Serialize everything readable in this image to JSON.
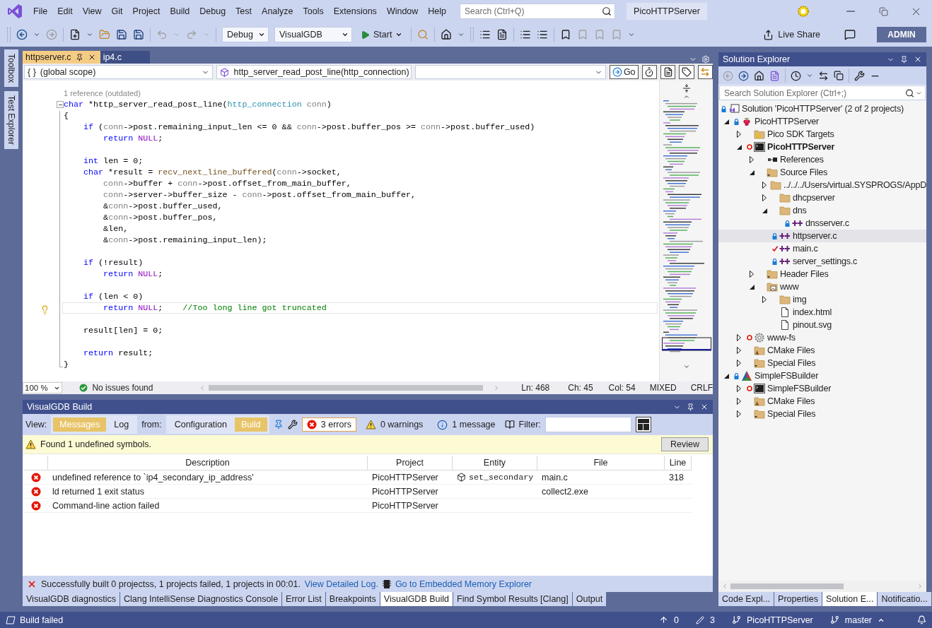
{
  "menu": [
    "File",
    "Edit",
    "View",
    "Git",
    "Project",
    "Build",
    "Debug",
    "Test",
    "Analyze",
    "Tools",
    "Extensions",
    "Window",
    "Help"
  ],
  "search": {
    "placeholder": "Search (Ctrl+Q)"
  },
  "solution_name": "PicoHTTPServer",
  "toolbar": {
    "configuration": "Debug",
    "platform": "VisualGDB",
    "start": "Start",
    "live_share": "Live Share",
    "account": "ADMIN"
  },
  "side_tabs": [
    "Toolbox",
    "Test Explorer"
  ],
  "editor": {
    "tabs": [
      {
        "label": "httpserver.c",
        "selected": true
      },
      {
        "label": "ip4.c",
        "selected": false
      }
    ],
    "scope_glyph": "{ }",
    "scope": "(global scope)",
    "function": "http_server_read_post_line(http_connection)",
    "go": "Go",
    "code_lens": "1 reference (outdated)",
    "lines": [
      {
        "current": false,
        "tokens": [
          {
            "kind": "kw",
            "t": "char"
          },
          {
            "kind": "p",
            "t": " *http_server_read_post_line("
          },
          {
            "kind": "type",
            "t": "http_connection"
          },
          {
            "kind": "param",
            "t": " conn"
          },
          {
            "kind": "p",
            "t": ")"
          }
        ]
      },
      {
        "current": false,
        "tokens": [
          {
            "kind": "p",
            "t": "{"
          }
        ]
      },
      {
        "current": false,
        "tokens": [
          {
            "kind": "kw",
            "t": "    if"
          },
          {
            "kind": "p",
            "t": " ("
          },
          {
            "kind": "param",
            "t": "conn"
          },
          {
            "kind": "p",
            "t": "->post.remaining_input_len <= 0 && "
          },
          {
            "kind": "param",
            "t": "conn"
          },
          {
            "kind": "p",
            "t": "->post.buffer_pos >= "
          },
          {
            "kind": "param",
            "t": "conn"
          },
          {
            "kind": "p",
            "t": "->post.buffer_used)"
          }
        ]
      },
      {
        "current": false,
        "tokens": [
          {
            "kind": "kw",
            "t": "        return"
          },
          {
            "kind": "macro",
            "t": " NULL"
          },
          {
            "kind": "p",
            "t": ";"
          }
        ]
      },
      {
        "current": false
      },
      {
        "current": false,
        "tokens": [
          {
            "kind": "kw",
            "t": "    int"
          },
          {
            "kind": "p",
            "t": " len = 0;"
          }
        ]
      },
      {
        "current": false,
        "tokens": [
          {
            "kind": "kw",
            "t": "    char"
          },
          {
            "kind": "p",
            "t": " *result = "
          },
          {
            "kind": "func",
            "t": "recv_next_line_buffered"
          },
          {
            "kind": "p",
            "t": "("
          },
          {
            "kind": "param",
            "t": "conn"
          },
          {
            "kind": "p",
            "t": "->socket,"
          }
        ]
      },
      {
        "current": false,
        "tokens": [
          {
            "kind": "param",
            "t": "        conn"
          },
          {
            "kind": "p",
            "t": "->buffer + "
          },
          {
            "kind": "param",
            "t": "conn"
          },
          {
            "kind": "p",
            "t": "->post.offset_from_main_buffer,"
          }
        ]
      },
      {
        "current": false,
        "tokens": [
          {
            "kind": "param",
            "t": "        conn"
          },
          {
            "kind": "p",
            "t": "->server->buffer_size - "
          },
          {
            "kind": "param",
            "t": "conn"
          },
          {
            "kind": "p",
            "t": "->post.offset_from_main_buffer,"
          }
        ]
      },
      {
        "current": false,
        "tokens": [
          {
            "kind": "p",
            "t": "        &"
          },
          {
            "kind": "param",
            "t": "conn"
          },
          {
            "kind": "p",
            "t": "->post.buffer_used,"
          }
        ]
      },
      {
        "current": false,
        "tokens": [
          {
            "kind": "p",
            "t": "        &"
          },
          {
            "kind": "param",
            "t": "conn"
          },
          {
            "kind": "p",
            "t": "->post.buffer_pos,"
          }
        ]
      },
      {
        "current": false,
        "tokens": [
          {
            "kind": "p",
            "t": "        &len,"
          }
        ]
      },
      {
        "current": false,
        "tokens": [
          {
            "kind": "p",
            "t": "        &"
          },
          {
            "kind": "param",
            "t": "conn"
          },
          {
            "kind": "p",
            "t": "->post.remaining_input_len);"
          }
        ]
      },
      {
        "current": false
      },
      {
        "current": false,
        "tokens": [
          {
            "kind": "kw",
            "t": "    if"
          },
          {
            "kind": "p",
            "t": " (!result)"
          }
        ]
      },
      {
        "current": false,
        "tokens": [
          {
            "kind": "kw",
            "t": "        return"
          },
          {
            "kind": "macro",
            "t": " NULL"
          },
          {
            "kind": "p",
            "t": ";"
          }
        ]
      },
      {
        "current": false
      },
      {
        "current": false,
        "tokens": [
          {
            "kind": "kw",
            "t": "    if"
          },
          {
            "kind": "p",
            "t": " (len < 0)"
          }
        ]
      },
      {
        "current": true,
        "tokens": [
          {
            "kind": "kw",
            "t": "        return"
          },
          {
            "kind": "macro",
            "t": " NULL"
          },
          {
            "kind": "p",
            "t": ";    "
          },
          {
            "kind": "comment",
            "t": "//Too long line got truncated"
          }
        ]
      },
      {
        "current": false
      },
      {
        "current": false,
        "tokens": [
          {
            "kind": "p",
            "t": "    result[len] = 0;"
          }
        ]
      },
      {
        "current": false
      },
      {
        "current": false,
        "tokens": [
          {
            "kind": "kw",
            "t": "    return"
          },
          {
            "kind": "p",
            "t": " result;"
          }
        ]
      },
      {
        "current": false,
        "tokens": [
          {
            "kind": "p",
            "t": "}"
          }
        ]
      }
    ],
    "zoom": "100 %",
    "issues": "No issues found",
    "position": [
      "Ln: 468",
      "Ch: 45",
      "Col: 54",
      "MIXED",
      "CRLF"
    ]
  },
  "build": {
    "title": "VisualGDB Build",
    "view_label": "View:",
    "view": [
      {
        "label": "Messages",
        "selected": true
      },
      {
        "label": "Log",
        "selected": false
      }
    ],
    "from_label": "from:",
    "from": [
      {
        "label": "Configuration",
        "selected": false
      },
      {
        "label": "Build",
        "selected": true
      }
    ],
    "counts": [
      {
        "kind": "error",
        "label": "3 errors",
        "selected": true
      },
      {
        "kind": "warning",
        "label": "0 warnings",
        "selected": false
      },
      {
        "kind": "message",
        "label": "1 message",
        "selected": false
      }
    ],
    "filter_label": "Filter:",
    "notice": "Found 1 undefined symbols.",
    "review": "Review",
    "columns": [
      "Description",
      "Project",
      "Entity",
      "File",
      "Line"
    ],
    "rows": [
      {
        "description": "undefined reference to `ip4_secondary_ip_address'",
        "project": "PicoHTTPServer",
        "entity": "set_secondary",
        "file": "main.c",
        "line": "318"
      },
      {
        "description": "ld returned 1 exit status",
        "project": "PicoHTTPServer",
        "file": "collect2.exe"
      },
      {
        "description": "Command-line action failed",
        "project": "PicoHTTPServer"
      }
    ],
    "footer": "Successfully built 0 projectss, 1 projects failed, 1 projects in 00:01.",
    "log_link": "View Detailed Log.",
    "memory_link": "Go to Embedded Memory Explorer"
  },
  "bottom_tabs": [
    {
      "label": "VisualGDB diagnostics",
      "selected": false
    },
    {
      "label": "Clang IntelliSense Diagnostics Console",
      "selected": false
    },
    {
      "label": "Error List",
      "selected": false
    },
    {
      "label": "Breakpoints",
      "selected": false
    },
    {
      "label": "VisualGDB Build",
      "selected": true
    },
    {
      "label": "Find Symbol Results [Clang]",
      "selected": false
    },
    {
      "label": "Output",
      "selected": false
    }
  ],
  "solution_explorer": {
    "title": "Solution Explorer",
    "placeholder": "Search Solution Explorer (Ctrl+;)",
    "tree": [
      {
        "label": "Solution 'PicoHTTPServer' (2 of 2 projects)",
        "kind": "solution",
        "badge": {
          "kind": "lock"
        },
        "selected": false,
        "bold": false,
        "children": [
          {
            "label": "PicoHTTPServer",
            "kind": "raspberry",
            "badge": {
              "kind": "lock"
            },
            "selected": false,
            "bold": false,
            "expanded": true,
            "children": [
              {
                "label": "Pico SDK Targets",
                "kind": "sdk-folder",
                "selected": false,
                "bold": false,
                "expanded": false
              },
              {
                "label": "PicoHTTPServer",
                "kind": "console",
                "badge": {
                  "kind": "error"
                },
                "selected": false,
                "bold": true,
                "expanded": true,
                "children": [
                  {
                    "label": "References",
                    "kind": "references",
                    "selected": false,
                    "bold": false,
                    "expanded": false
                  },
                  {
                    "label": "Source Files",
                    "kind": "filter-folder",
                    "selected": false,
                    "bold": false,
                    "expanded": true,
                    "children": [
                      {
                        "label": "../../../Users/virtual.SYSPROGS/AppD",
                        "kind": "folder",
                        "selected": false,
                        "bold": false,
                        "expanded": false
                      },
                      {
                        "label": "dhcpserver",
                        "kind": "folder",
                        "selected": false,
                        "bold": false,
                        "expanded": false
                      },
                      {
                        "label": "dns",
                        "kind": "folder",
                        "selected": false,
                        "bold": false,
                        "expanded": true,
                        "children": [
                          {
                            "label": "dnsserver.c",
                            "kind": "c-file",
                            "badge": {
                              "kind": "lock"
                            },
                            "selected": false,
                            "bold": false
                          }
                        ]
                      },
                      {
                        "label": "httpserver.c",
                        "kind": "c-file",
                        "badge": {
                          "kind": "lock"
                        },
                        "selected": true,
                        "bold": false
                      },
                      {
                        "label": "main.c",
                        "kind": "c-file",
                        "badge": {
                          "kind": "check"
                        },
                        "selected": false,
                        "bold": false
                      },
                      {
                        "label": "server_settings.c",
                        "kind": "c-file",
                        "badge": {
                          "kind": "lock"
                        },
                        "selected": false,
                        "bold": false
                      }
                    ]
                  },
                  {
                    "label": "Header Files",
                    "kind": "filter-folder",
                    "selected": false,
                    "bold": false,
                    "expanded": false
                  },
                  {
                    "label": "www",
                    "kind": "image-folder",
                    "selected": false,
                    "bold": false,
                    "expanded": true,
                    "children": [
                      {
                        "label": "img",
                        "kind": "folder",
                        "selected": false,
                        "bold": false,
                        "expanded": false
                      },
                      {
                        "label": "index.html",
                        "kind": "file",
                        "selected": false,
                        "bold": false
                      },
                      {
                        "label": "pinout.svg",
                        "kind": "file",
                        "selected": false,
                        "bold": false
                      }
                    ]
                  }
                ]
              },
              {
                "label": "www-fs",
                "kind": "gear",
                "badge": {
                  "kind": "error"
                },
                "selected": false,
                "bold": false,
                "expanded": false
              },
              {
                "label": "CMake Files",
                "kind": "cmake-folder",
                "selected": false,
                "bold": false,
                "expanded": false
              },
              {
                "label": "Special Files",
                "kind": "filter-folder",
                "selected": false,
                "bold": false,
                "expanded": false
              }
            ]
          },
          {
            "label": "SimpleFSBuilder",
            "kind": "cmake",
            "badge": {
              "kind": "lock"
            },
            "selected": false,
            "bold": false,
            "expanded": true,
            "children": [
              {
                "label": "SimpleFSBuilder",
                "kind": "console",
                "badge": {
                  "kind": "error"
                },
                "selected": false,
                "bold": false,
                "expanded": false
              },
              {
                "label": "CMake Files",
                "kind": "cmake-folder",
                "selected": false,
                "bold": false,
                "expanded": false
              },
              {
                "label": "Special Files",
                "kind": "filter-folder",
                "selected": false,
                "bold": false,
                "expanded": false
              }
            ]
          }
        ]
      }
    ]
  },
  "right_tabs": [
    {
      "label": "Code Expl...",
      "selected": false
    },
    {
      "label": "Properties",
      "selected": false
    },
    {
      "label": "Solution E...",
      "selected": true
    },
    {
      "label": "Notificatio...",
      "selected": false
    }
  ],
  "status_bar": {
    "message": "Build failed",
    "pushes": "0",
    "changes": "3",
    "repository": "PicoHTTPServer",
    "branch": "master"
  }
}
